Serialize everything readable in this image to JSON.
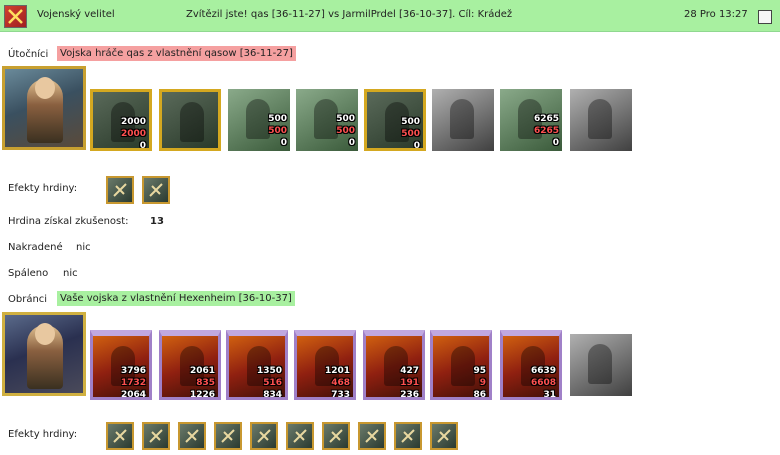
{
  "header": {
    "title": "Vojenský velitel",
    "result": "Zvítězil jste! qas [36-11-27] vs JarmilPrdel [36-10-37]. Cíl: Krádež",
    "date": "28 Pro 13:27"
  },
  "attackers": {
    "label": "Útočníci",
    "name": "Vojska hráče qas z vlastnění qasow [36-11-27]",
    "units": [
      {
        "icon": "dwarf-warrior-icon",
        "top": "2000",
        "mid": "2000",
        "bot": "0"
      },
      {
        "icon": "dark-knight-icon",
        "top": "",
        "mid": "",
        "bot": ""
      },
      {
        "icon": "swordsman-icon",
        "top": "500",
        "mid": "500",
        "bot": "0"
      },
      {
        "icon": "griffin-icon",
        "top": "500",
        "mid": "500",
        "bot": "0"
      },
      {
        "icon": "elf-archer-icon",
        "top": "500",
        "mid": "500",
        "bot": "0"
      },
      {
        "icon": "shade-icon",
        "top": "",
        "mid": "",
        "bot": ""
      },
      {
        "icon": "druid-icon",
        "top": "6265",
        "mid": "6265",
        "bot": "0"
      },
      {
        "icon": "ghost-icon",
        "top": "",
        "mid": "",
        "bot": ""
      }
    ],
    "effects_label": "Efekty hrdiny:",
    "effects": [
      "barricade-icon",
      "crossbow-icon"
    ]
  },
  "stats": {
    "exp_label": "Hrdina získal zkušenost:",
    "exp_value": "13",
    "stolen_label": "Nakradené",
    "stolen_value": "nic",
    "burned_label": "Spáleno",
    "burned_value": "nic"
  },
  "defenders": {
    "label": "Obránci",
    "name": "Vaše vojska z vlastnění Hexenheim [36-10-37]",
    "units": [
      {
        "icon": "imp-icon",
        "top": "3796",
        "mid": "1732",
        "bot": "2064"
      },
      {
        "icon": "skeleton-demon-icon",
        "top": "2061",
        "mid": "835",
        "bot": "1226"
      },
      {
        "icon": "hellhound-icon",
        "top": "1350",
        "mid": "516",
        "bot": "834"
      },
      {
        "icon": "gargoyle-icon",
        "top": "1201",
        "mid": "468",
        "bot": "733"
      },
      {
        "icon": "efreet-icon",
        "top": "427",
        "mid": "191",
        "bot": "236"
      },
      {
        "icon": "pit-fiend-icon",
        "top": "95",
        "mid": "9",
        "bot": "86"
      },
      {
        "icon": "devil-icon",
        "top": "6639",
        "mid": "6608",
        "bot": "31"
      },
      {
        "icon": "reaper-icon",
        "top": "",
        "mid": "",
        "bot": ""
      }
    ],
    "effects_label": "Efekty hrdiny:",
    "effects": [
      "tower-icon",
      "castle-wall-icon",
      "barricade-icon",
      "crown-icon",
      "pickaxe-icon",
      "potion-icon",
      "ring-icon",
      "scroll-icon",
      "staff-icon",
      "shield-icon"
    ]
  }
}
